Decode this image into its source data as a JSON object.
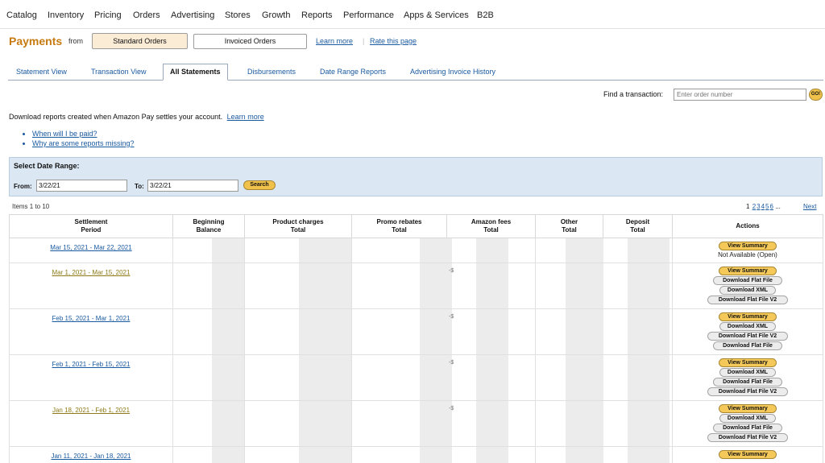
{
  "nav": [
    "Catalog",
    "Inventory",
    "Pricing",
    "Orders",
    "Advertising",
    "Stores",
    "Growth",
    "Reports",
    "Performance",
    "Apps & Services",
    "B2B"
  ],
  "header": {
    "title": "Payments",
    "from": "from",
    "standard_orders": "Standard Orders",
    "invoiced_orders": "Invoiced Orders",
    "learn_more": "Learn more",
    "separator": "|",
    "rate_page": "Rate this page"
  },
  "tabs": [
    "Statement View",
    "Transaction View",
    "All Statements",
    "Disbursements",
    "Date Range Reports",
    "Advertising Invoice History"
  ],
  "active_tab": "All Statements",
  "find": {
    "label": "Find a transaction:",
    "placeholder": "Enter order number",
    "go": "GO!"
  },
  "intro": {
    "text": "Download reports created when Amazon Pay settles your account.",
    "learn_more": "Learn more"
  },
  "help_links": [
    "When will I be paid?",
    "Why are some reports missing?"
  ],
  "date_range": {
    "title": "Select Date Range:",
    "from_label": "From:",
    "from_value": "3/22/21",
    "to_label": "To:",
    "to_value": "3/22/21",
    "search": "Search"
  },
  "items_count": "Items 1 to 10",
  "pager": {
    "current": "1",
    "pages": [
      "2",
      "3",
      "4",
      "5",
      "6"
    ],
    "ellipsis": "...",
    "next": "Next"
  },
  "table": {
    "headers": [
      [
        "Settlement",
        "Period"
      ],
      [
        "Beginning",
        "Balance"
      ],
      [
        "Product charges",
        "Total"
      ],
      [
        "Promo rebates",
        "Total"
      ],
      [
        "Amazon fees",
        "Total"
      ],
      [
        "Other",
        "Total"
      ],
      [
        "Deposit",
        "Total"
      ],
      [
        "Actions",
        ""
      ]
    ],
    "rows": [
      {
        "period": "Mar 15, 2021 - Mar 22, 2021",
        "actions": [
          "View Summary"
        ],
        "note": "Not Available (Open)",
        "fee_sign": ""
      },
      {
        "period": "Mar 1, 2021 - Mar 15, 2021",
        "actions": [
          "View Summary",
          "Download Flat File",
          "Download XML",
          "Download Flat File V2"
        ],
        "note": "",
        "fee_sign": "-$"
      },
      {
        "period": "Feb 15, 2021 - Mar 1, 2021",
        "actions": [
          "View Summary",
          "Download XML",
          "Download Flat File V2",
          "Download Flat File"
        ],
        "note": "",
        "fee_sign": "-$"
      },
      {
        "period": "Feb 1, 2021 - Feb 15, 2021",
        "actions": [
          "View Summary",
          "Download XML",
          "Download Flat File",
          "Download Flat File V2"
        ],
        "note": "",
        "fee_sign": "-$"
      },
      {
        "period": "Jan 18, 2021 - Feb 1, 2021",
        "actions": [
          "View Summary",
          "Download XML",
          "Download Flat File",
          "Download Flat File V2"
        ],
        "note": "",
        "fee_sign": "-$"
      },
      {
        "period": "Jan 11, 2021 - Jan 18, 2021",
        "actions": [
          "View Summary"
        ],
        "note": "",
        "fee_sign": ""
      }
    ]
  }
}
